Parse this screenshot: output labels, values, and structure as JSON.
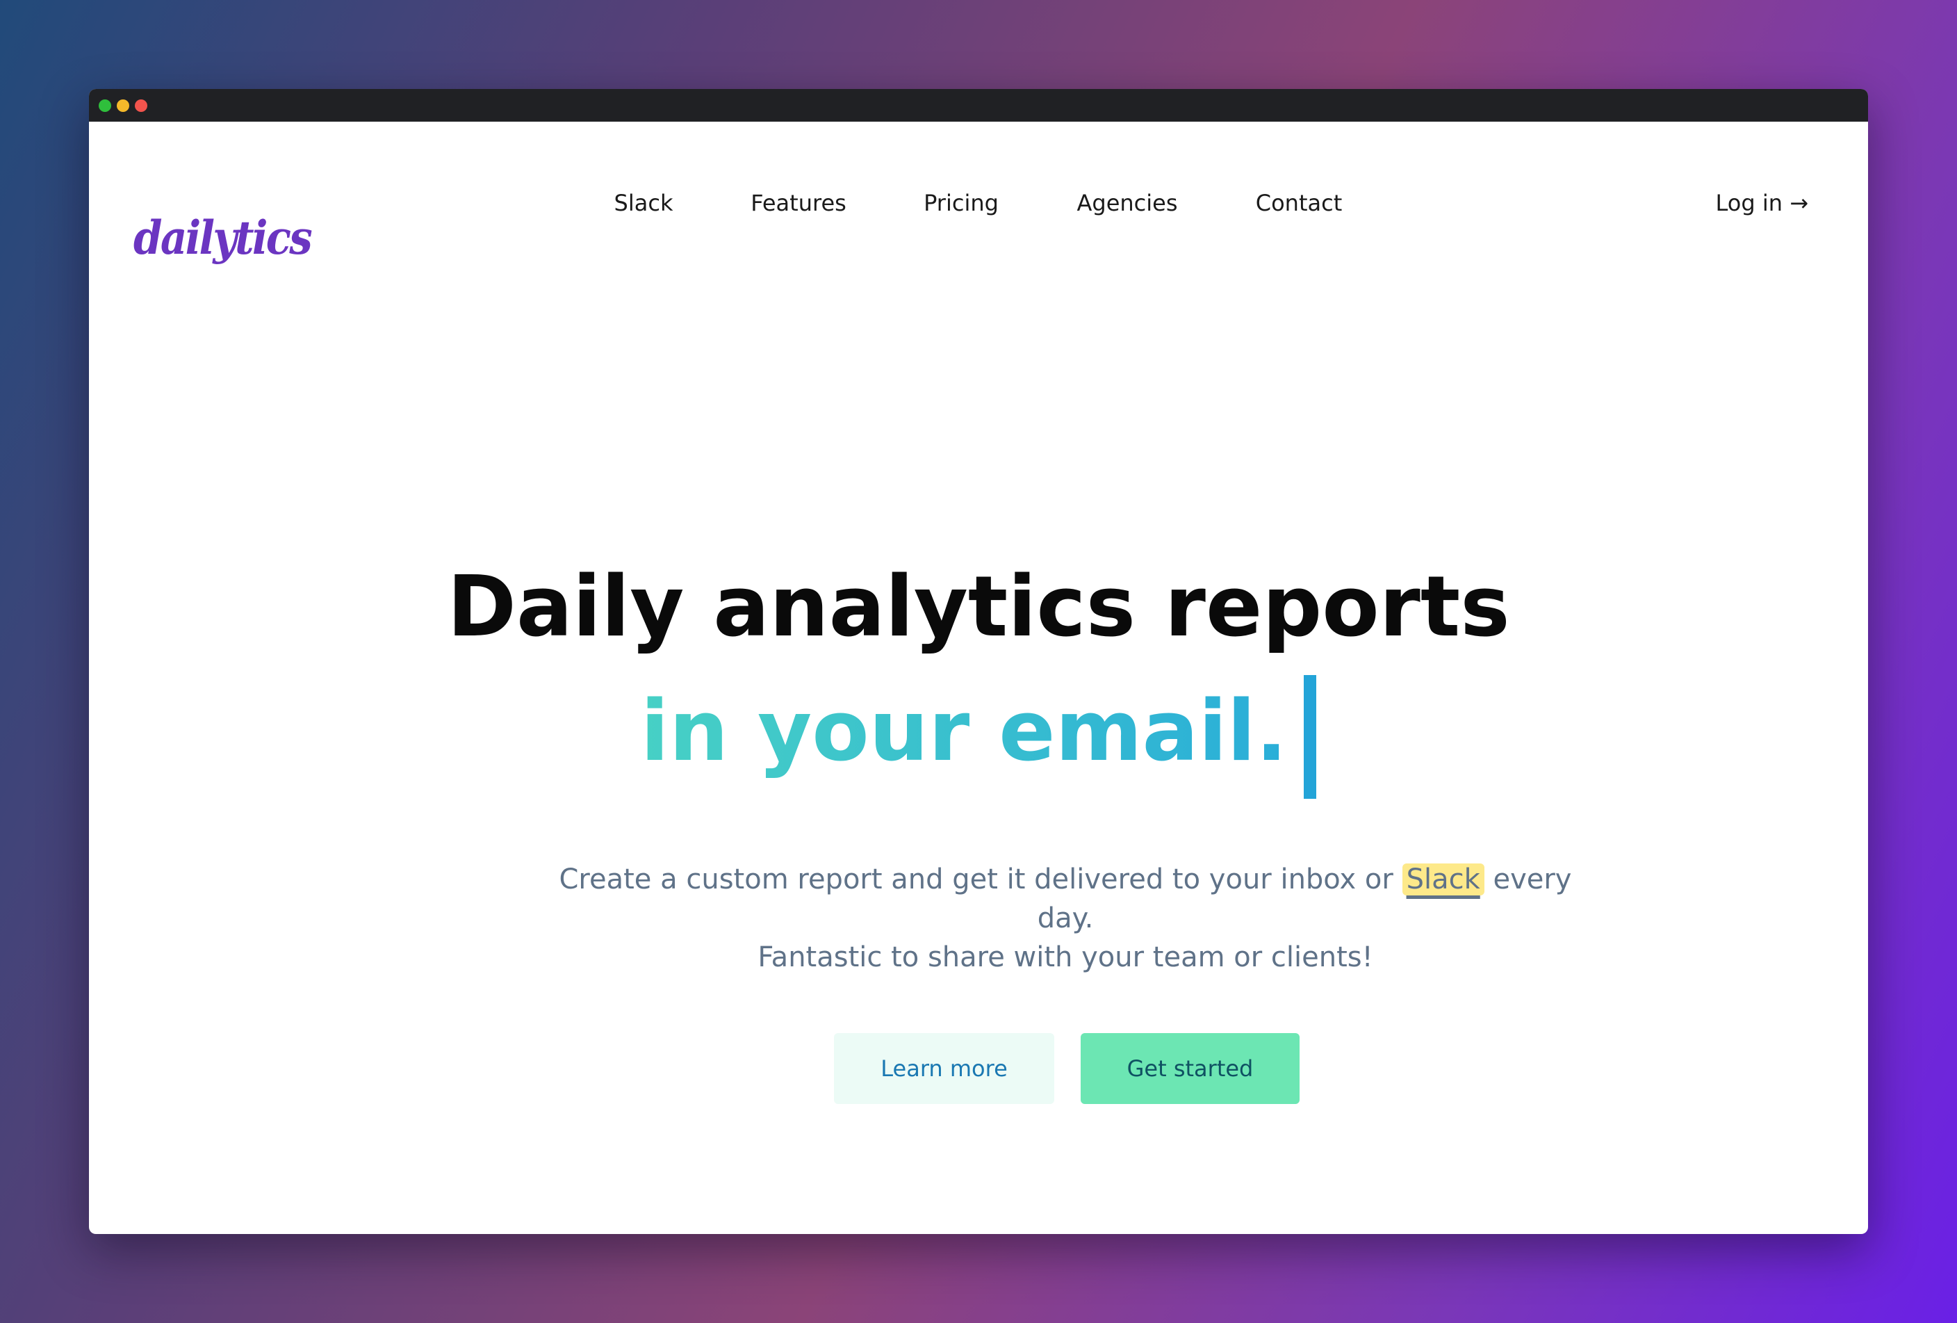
{
  "brand": {
    "logo_text": "dailytics"
  },
  "nav": {
    "items": [
      {
        "label": "Slack"
      },
      {
        "label": "Features"
      },
      {
        "label": "Pricing"
      },
      {
        "label": "Agencies"
      },
      {
        "label": "Contact"
      }
    ],
    "login_label": "Log in →"
  },
  "hero": {
    "headline": "Daily analytics reports",
    "typed_text": "in your email.",
    "subtitle_before": "Create a custom report and get it delivered to your inbox or ",
    "subtitle_highlight": "Slack",
    "subtitle_after": " every day.",
    "subtitle_line2": "Fantastic to share with your team or clients!"
  },
  "cta": {
    "learn_more": "Learn more",
    "get_started": "Get started"
  },
  "colors": {
    "brand_purple": "#6b35c1",
    "accent_teal": "#47d0c5",
    "accent_blue": "#2aaed8",
    "button_green": "#6ce6b3",
    "highlight_yellow": "#fde98a"
  }
}
